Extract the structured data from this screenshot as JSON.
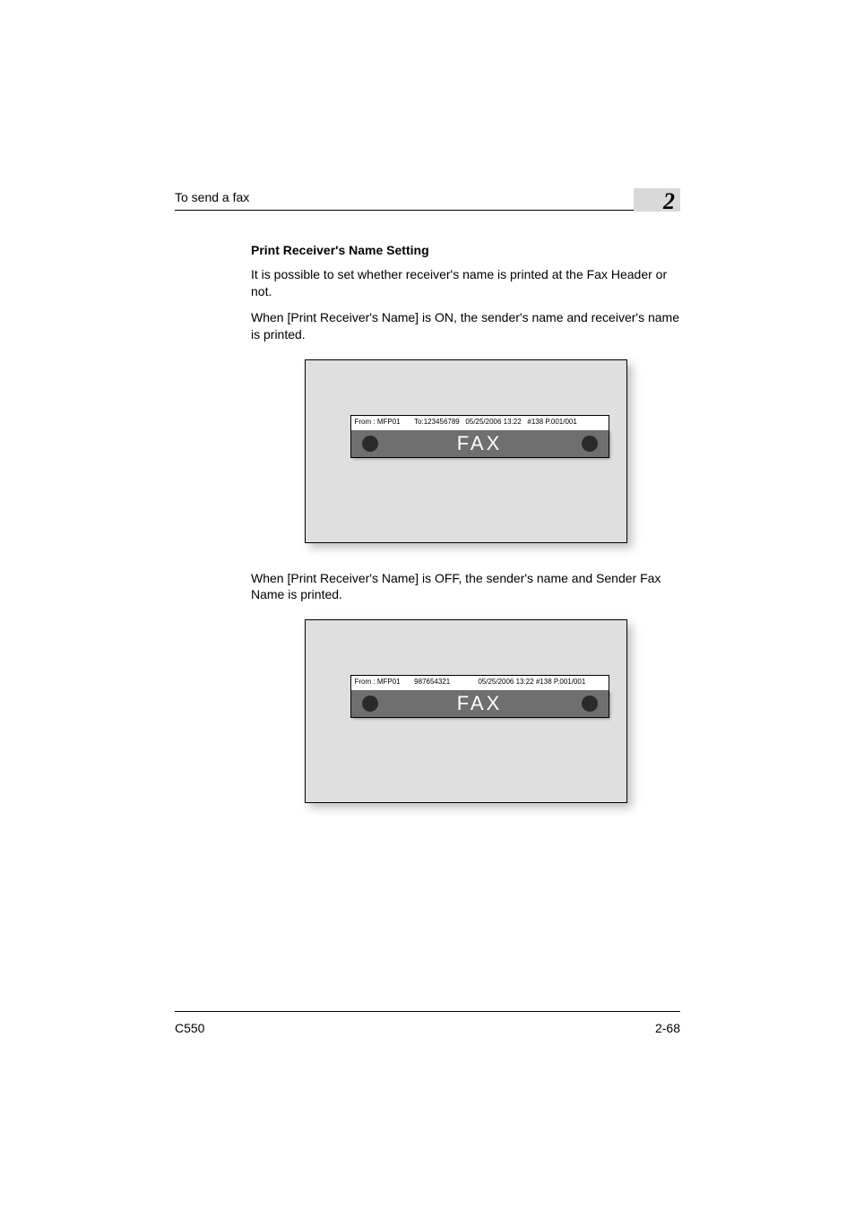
{
  "header": {
    "running_title": "To send a fax",
    "chapter_number": "2"
  },
  "body": {
    "heading": "Print Receiver's Name Setting",
    "para1": "It is possible to set whether receiver's name is printed at the Fax Header or not.",
    "para2": "When [Print Receiver's Name] is ON, the sender's name and receiver's name is printed.",
    "para3": "When [Print Receiver's Name] is OFF, the sender's name and Sender Fax Name is printed."
  },
  "figures": {
    "on": {
      "header_line": "From : MFP01       To:123456789   05/25/2006 13:22   #138 P.001/001",
      "band_label": "FAX"
    },
    "off": {
      "header_line": "From : MFP01       987654321              05/25/2006 13:22 #138 P.001/001",
      "band_label": "FAX"
    }
  },
  "footer": {
    "model": "C550",
    "page": "2-68"
  }
}
